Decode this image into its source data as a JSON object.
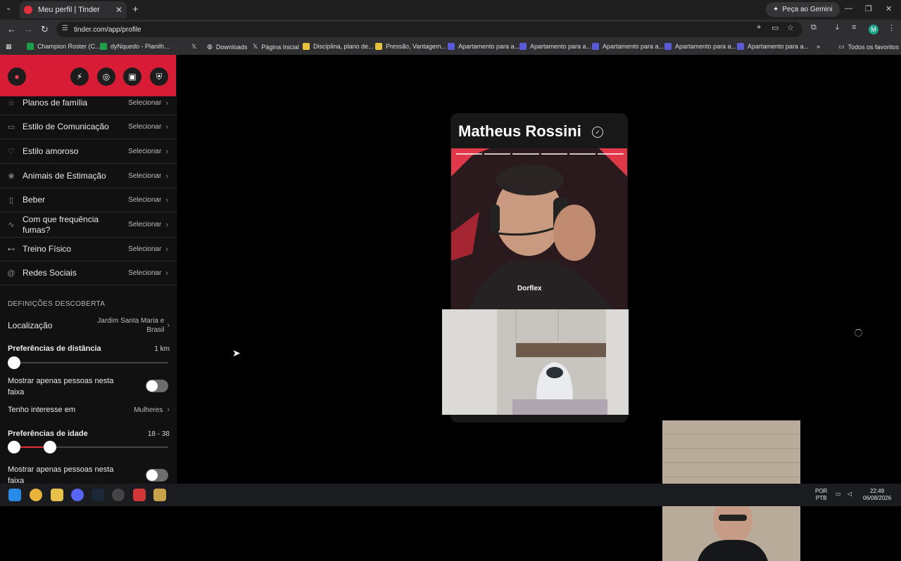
{
  "browser": {
    "tab_title": "Meu perfil | Tinder",
    "url": "tinder.com/app/profile",
    "gemini_label": "Peça ao Gemini",
    "avatar_letter": "M",
    "bookmarks": [
      {
        "label": "Champion Roster (C...",
        "color": "#1e9e4a"
      },
      {
        "label": "dyNquedo - Planilh...",
        "color": "#1e9e4a"
      },
      {
        "label": "",
        "color": "#555555"
      },
      {
        "label": "",
        "color": "#cccccc"
      },
      {
        "label": "Downloads",
        "color": "#cccccc"
      },
      {
        "label": "Página Inicial",
        "color": "#cccccc"
      },
      {
        "label": "Disciplina, plano de...",
        "color": "#e8c13a"
      },
      {
        "label": "Pressão, Vantagem...",
        "color": "#e8c13a"
      },
      {
        "label": "Apartamento para a...",
        "color": "#5a5ad6"
      },
      {
        "label": "Apartamento para a...",
        "color": "#5a5ad6"
      },
      {
        "label": "Apartamento para a...",
        "color": "#5a5ad6"
      },
      {
        "label": "Apartamento para a...",
        "color": "#5a5ad6"
      },
      {
        "label": "Apartamento para a...",
        "color": "#5a5ad6"
      }
    ],
    "all_bookmarks": "Todos os favoritos"
  },
  "sidebar": {
    "rows": [
      {
        "label": "Planos de família",
        "value": "Selecionar",
        "icon": "family-icon"
      },
      {
        "label": "Estilo de Comunicação",
        "value": "Selecionar",
        "icon": "chat-icon"
      },
      {
        "label": "Estilo amoroso",
        "value": "Selecionar",
        "icon": "heart-chat-icon"
      },
      {
        "label": "Animais de Estimação",
        "value": "Selecionar",
        "icon": "paw-icon"
      },
      {
        "label": "Beber",
        "value": "Selecionar",
        "icon": "drink-icon"
      },
      {
        "label": "Com que frequência fumas?",
        "value": "Selecionar",
        "icon": "smoke-icon"
      },
      {
        "label": "Treino Físico",
        "value": "Selecionar",
        "icon": "dumbbell-icon"
      },
      {
        "label": "Redes Sociais",
        "value": "Selecionar",
        "icon": "at-icon"
      }
    ],
    "discovery_title": "DEFINIÇÕES DESCOBERTA",
    "location_label": "Localização",
    "location_value": "Jardim Santa Maria e Brasil",
    "distance_label": "Preferências de distância",
    "distance_value": "1 km",
    "distance_fraction": 0.0,
    "only_range_label": "Mostrar apenas pessoas nesta faixa",
    "interest_label": "Tenho interesse em",
    "interest_value": "Mulheres",
    "age_label": "Preferências de idade",
    "age_value": "18 - 38",
    "age_min": 18,
    "age_max": 38,
    "only_range_label_2": "Mostrar apenas pessoas nesta faixa"
  },
  "card": {
    "name": "Matheus Rossini",
    "shirt_text": "Dorflex"
  },
  "taskbar": {
    "lang_top": "POR",
    "lang_bottom": "PTB",
    "time": "22:49",
    "date": "06/08/2026"
  }
}
